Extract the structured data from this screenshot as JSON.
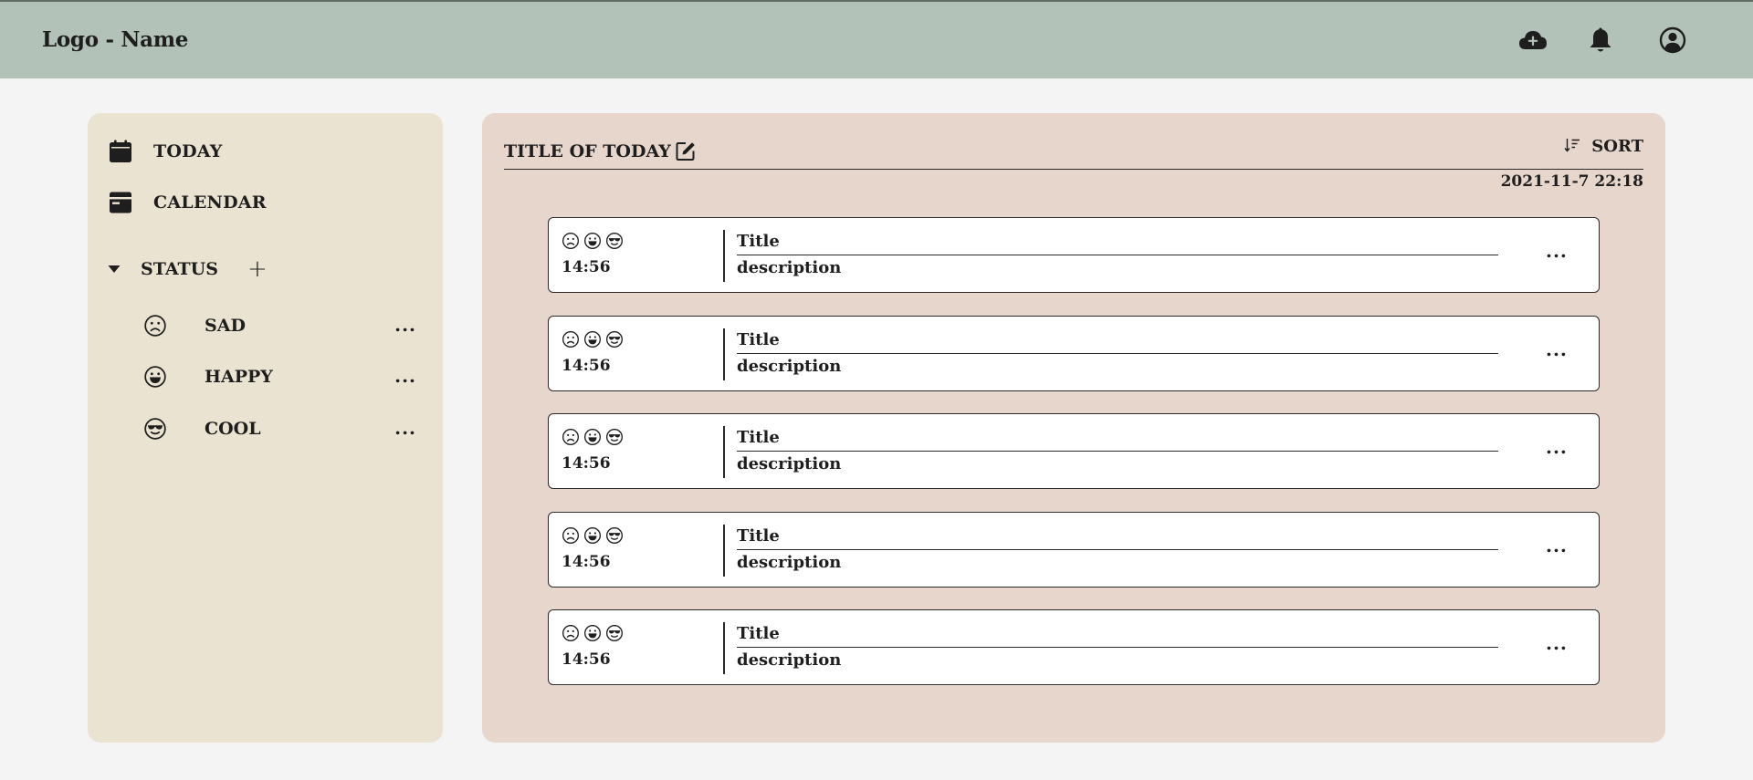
{
  "header": {
    "logo": "Logo - Name",
    "icons": [
      "cloud-upload-icon",
      "bell-icon",
      "user-circle-icon"
    ]
  },
  "colors": {
    "header_bg": "#b3c2b8",
    "sidebar_bg": "#ebe3d1",
    "main_bg": "#e7d6cc",
    "page_bg": "#f4f4f4"
  },
  "sidebar": {
    "nav": [
      {
        "label": "TODAY",
        "icon": "calendar-today-icon"
      },
      {
        "label": "CALENDAR",
        "icon": "calendar-icon"
      }
    ],
    "status_header": "STATUS",
    "add_symbol": "+",
    "statuses": [
      {
        "label": "SAD",
        "icon": "sad-face-icon",
        "more": "..."
      },
      {
        "label": "HAPPY",
        "icon": "happy-face-icon",
        "more": "..."
      },
      {
        "label": "COOL",
        "icon": "cool-face-icon",
        "more": "..."
      }
    ]
  },
  "main": {
    "title": "TITLE OF TODAY",
    "sort_label": "SORT",
    "datetime": "2021-11-7 22:18",
    "entries": [
      {
        "time": "14:56",
        "title": "Title",
        "description": "description",
        "more": "...",
        "moods": [
          "sad-face-icon",
          "happy-face-icon",
          "cool-face-icon"
        ]
      },
      {
        "time": "14:56",
        "title": "Title",
        "description": "description",
        "more": "...",
        "moods": [
          "sad-face-icon",
          "happy-face-icon",
          "cool-face-icon"
        ]
      },
      {
        "time": "14:56",
        "title": "Title",
        "description": "description",
        "more": "...",
        "moods": [
          "sad-face-icon",
          "happy-face-icon",
          "cool-face-icon"
        ]
      },
      {
        "time": "14:56",
        "title": "Title",
        "description": "description",
        "more": "...",
        "moods": [
          "sad-face-icon",
          "happy-face-icon",
          "cool-face-icon"
        ]
      },
      {
        "time": "14:56",
        "title": "Title",
        "description": "description",
        "more": "...",
        "moods": [
          "sad-face-icon",
          "happy-face-icon",
          "cool-face-icon"
        ]
      }
    ]
  }
}
